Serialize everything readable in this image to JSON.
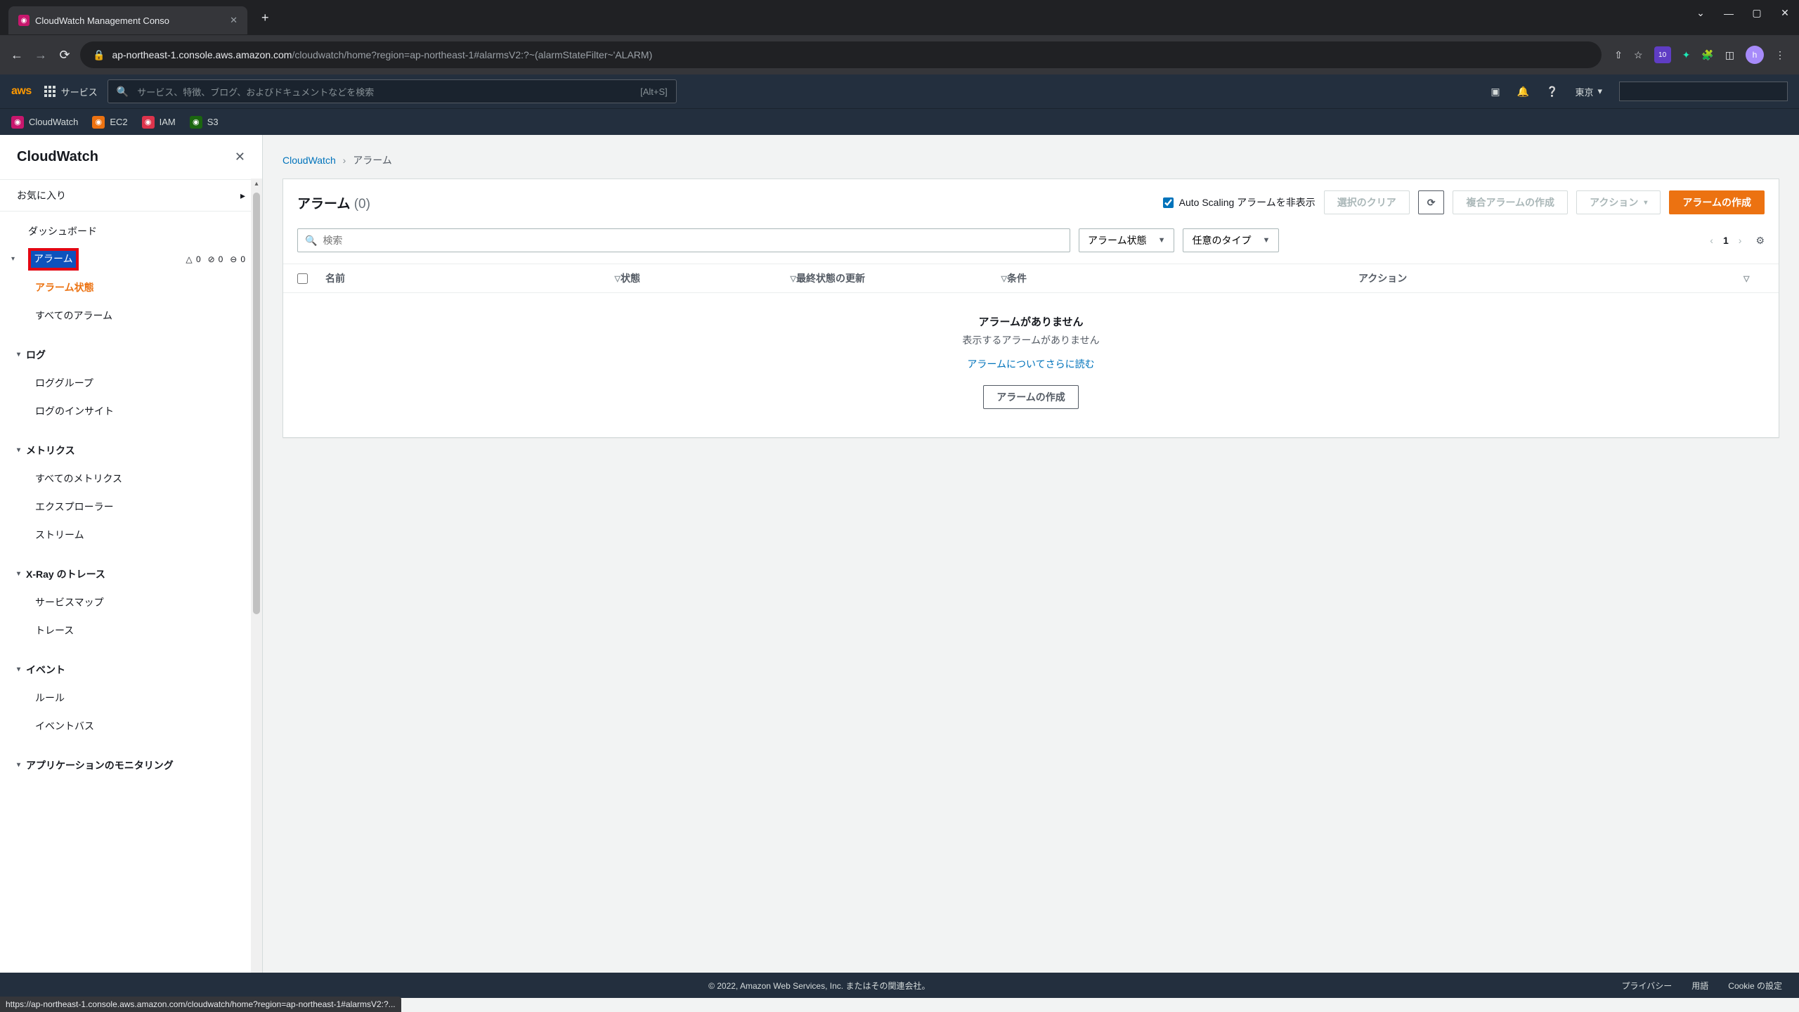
{
  "browser": {
    "tab_title": "CloudWatch Management Conso",
    "url_host": "ap-northeast-1.console.aws.amazon.com",
    "url_path": "/cloudwatch/home?region=ap-northeast-1#alarmsV2:?~(alarmStateFilter~'ALARM)",
    "avatar_initial": "h",
    "ext_badge": "10",
    "window_min": "—",
    "window_max": "▢",
    "window_close": "✕",
    "status_url": "https://ap-northeast-1.console.aws.amazon.com/cloudwatch/home?region=ap-northeast-1#alarmsV2:?..."
  },
  "aws_header": {
    "logo": "aws",
    "services": "サービス",
    "search_placeholder": "サービス、特徴、ブログ、およびドキュメントなどを検索",
    "search_shortcut": "[Alt+S]",
    "region": "東京",
    "favorites": [
      {
        "label": "CloudWatch",
        "color": "#c8176d"
      },
      {
        "label": "EC2",
        "color": "#ec7211"
      },
      {
        "label": "IAM",
        "color": "#dd344c"
      },
      {
        "label": "S3",
        "color": "#1b660f"
      }
    ]
  },
  "sidebar": {
    "title": "CloudWatch",
    "favorites_label": "お気に入り",
    "dashboard": "ダッシュボード",
    "alarm_group": "アラーム",
    "alarm_counts": {
      "warn": "0",
      "ok": "0",
      "insuf": "0"
    },
    "alarm_state": "アラーム状態",
    "all_alarms": "すべてのアラーム",
    "log_group": "ログ",
    "log_groups": "ロググループ",
    "log_insights": "ログのインサイト",
    "metrics_group": "メトリクス",
    "all_metrics": "すべてのメトリクス",
    "explorer": "エクスプローラー",
    "stream": "ストリーム",
    "xray_group": "X-Ray のトレース",
    "service_map": "サービスマップ",
    "trace": "トレース",
    "event_group": "イベント",
    "rule": "ルール",
    "event_bus": "イベントバス",
    "app_monitoring": "アプリケーションのモニタリング"
  },
  "breadcrumb": {
    "root": "CloudWatch",
    "current": "アラーム"
  },
  "panel": {
    "title": "アラーム",
    "count": "(0)",
    "hide_autoscaling": "Auto Scaling アラームを非表示",
    "clear_selection": "選択のクリア",
    "composite_alarm": "複合アラームの作成",
    "actions": "アクション",
    "create_alarm": "アラームの作成",
    "search_placeholder": "検索",
    "filter_state": "アラーム状態",
    "filter_type": "任意のタイプ",
    "page": "1",
    "columns": {
      "name": "名前",
      "state": "状態",
      "updated": "最終状態の更新",
      "condition": "条件",
      "actions": "アクション"
    },
    "empty": {
      "title": "アラームがありません",
      "subtitle": "表示するアラームがありません",
      "link": "アラームについてさらに読む",
      "button": "アラームの作成"
    }
  },
  "footer": {
    "copyright": "© 2022, Amazon Web Services, Inc. またはその関連会社。",
    "privacy": "プライバシー",
    "terms": "用語",
    "cookie": "Cookie の設定"
  }
}
